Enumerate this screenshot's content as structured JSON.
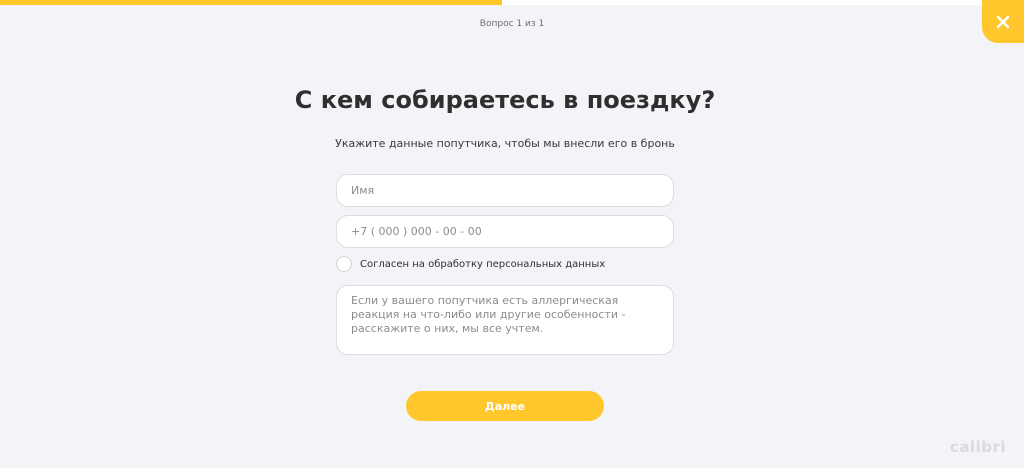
{
  "progress": {
    "percent": 49
  },
  "header": {
    "question_counter": "Вопрос 1 из 1",
    "close_icon": "close-icon"
  },
  "main": {
    "title": "С кем собираетесь в поездку?",
    "subtitle": "Укажите данные попутчика, чтобы мы внесли его в бронь"
  },
  "form": {
    "name_placeholder": "Имя",
    "phone_placeholder": "+7 ( 000 ) 000 - 00 - 00",
    "consent_label": "Согласен на обработку персональных данных",
    "comment_placeholder": "Если у вашего попутчика есть аллергическая реакция на что-либо или другие особенности - расскажите о них, мы все учтем.",
    "submit_label": "Далее"
  },
  "footer": {
    "brand": "calibri"
  },
  "colors": {
    "accent": "#ffc72c",
    "background": "#f3f4f7"
  }
}
